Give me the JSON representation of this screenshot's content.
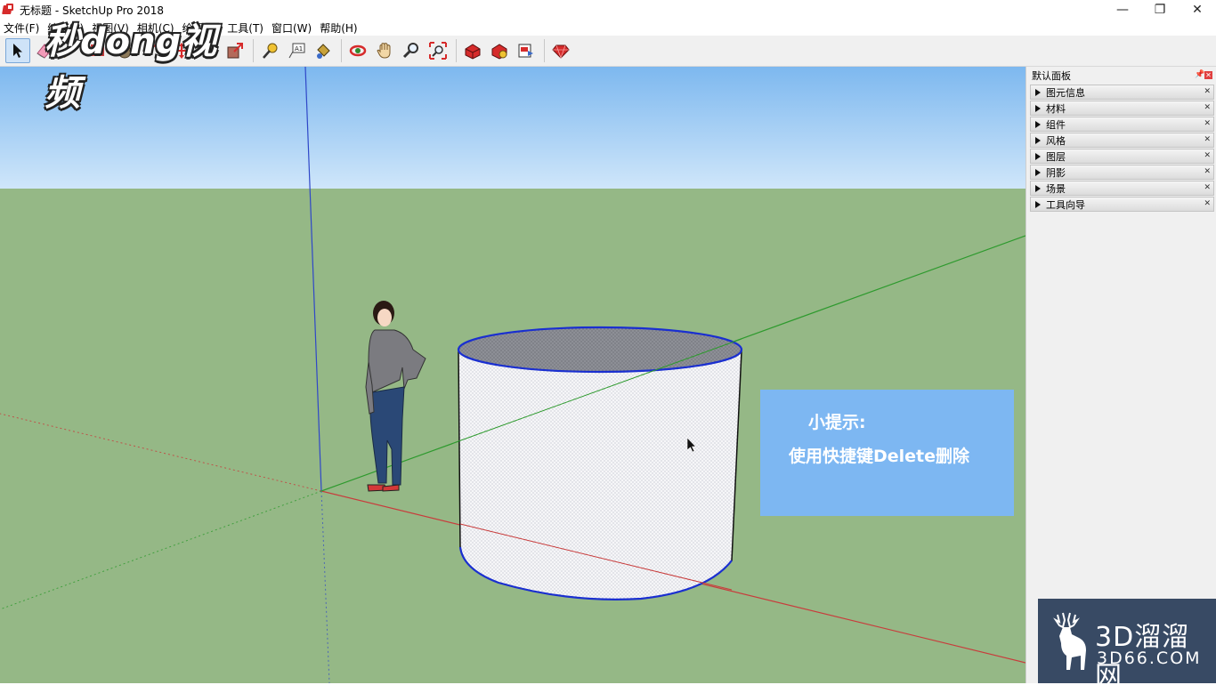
{
  "window": {
    "title": "无标题 - SketchUp Pro 2018",
    "controls": {
      "minimize": "—",
      "maximize": "❐",
      "close": "✕"
    }
  },
  "menu": [
    "文件(F)",
    "编辑(E)",
    "视图(V)",
    "相机(C)",
    "绘图(R)",
    "工具(T)",
    "窗口(W)",
    "帮助(H)"
  ],
  "toolbar": {
    "tools": [
      "select-icon",
      "eraser-icon",
      "pencil-icon",
      "shape-icon",
      "push-pull-icon",
      "offset-icon",
      "move-icon",
      "rotate-icon",
      "scale-icon",
      "tape-measure-icon",
      "text-icon",
      "paint-bucket-icon",
      "orbit-icon",
      "pan-icon",
      "zoom-icon",
      "zoom-extents-icon",
      "warehouse-icon",
      "extension-warehouse-icon",
      "layout-icon",
      "ruby-icon"
    ]
  },
  "overlay_logo": "秒dong视频",
  "tip": {
    "title": "小提示:",
    "body": "使用快捷键Delete删除"
  },
  "panel": {
    "title": "默认面板",
    "trays": [
      "图元信息",
      "材料",
      "组件",
      "风格",
      "图层",
      "阴影",
      "场景",
      "工具向导"
    ]
  },
  "watermark": {
    "main": "3D溜溜网",
    "sub": "3D66.COM"
  },
  "colors": {
    "sky": "#86bff0",
    "ground": "#95b886",
    "tip_bg": "#7db7f2",
    "axis_red": "#c83c3c",
    "axis_green": "#2e9a2e",
    "axis_blue": "#2f47c8"
  }
}
